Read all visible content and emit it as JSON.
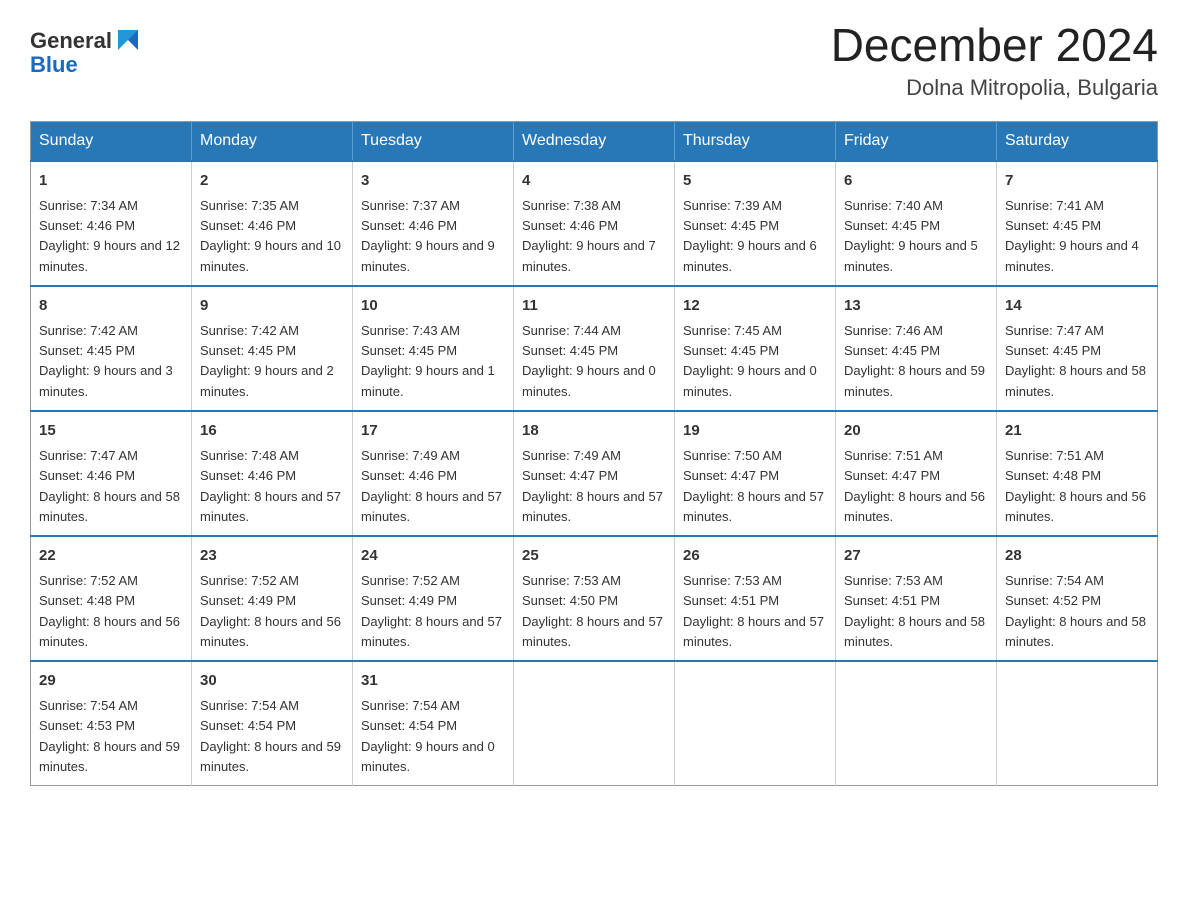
{
  "logo": {
    "text_general": "General",
    "text_blue": "Blue"
  },
  "header": {
    "month_title": "December 2024",
    "location": "Dolna Mitropolia, Bulgaria"
  },
  "weekdays": [
    "Sunday",
    "Monday",
    "Tuesday",
    "Wednesday",
    "Thursday",
    "Friday",
    "Saturday"
  ],
  "weeks": [
    [
      {
        "day": "1",
        "sunrise": "7:34 AM",
        "sunset": "4:46 PM",
        "daylight": "9 hours and 12 minutes."
      },
      {
        "day": "2",
        "sunrise": "7:35 AM",
        "sunset": "4:46 PM",
        "daylight": "9 hours and 10 minutes."
      },
      {
        "day": "3",
        "sunrise": "7:37 AM",
        "sunset": "4:46 PM",
        "daylight": "9 hours and 9 minutes."
      },
      {
        "day": "4",
        "sunrise": "7:38 AM",
        "sunset": "4:46 PM",
        "daylight": "9 hours and 7 minutes."
      },
      {
        "day": "5",
        "sunrise": "7:39 AM",
        "sunset": "4:45 PM",
        "daylight": "9 hours and 6 minutes."
      },
      {
        "day": "6",
        "sunrise": "7:40 AM",
        "sunset": "4:45 PM",
        "daylight": "9 hours and 5 minutes."
      },
      {
        "day": "7",
        "sunrise": "7:41 AM",
        "sunset": "4:45 PM",
        "daylight": "9 hours and 4 minutes."
      }
    ],
    [
      {
        "day": "8",
        "sunrise": "7:42 AM",
        "sunset": "4:45 PM",
        "daylight": "9 hours and 3 minutes."
      },
      {
        "day": "9",
        "sunrise": "7:42 AM",
        "sunset": "4:45 PM",
        "daylight": "9 hours and 2 minutes."
      },
      {
        "day": "10",
        "sunrise": "7:43 AM",
        "sunset": "4:45 PM",
        "daylight": "9 hours and 1 minute."
      },
      {
        "day": "11",
        "sunrise": "7:44 AM",
        "sunset": "4:45 PM",
        "daylight": "9 hours and 0 minutes."
      },
      {
        "day": "12",
        "sunrise": "7:45 AM",
        "sunset": "4:45 PM",
        "daylight": "9 hours and 0 minutes."
      },
      {
        "day": "13",
        "sunrise": "7:46 AM",
        "sunset": "4:45 PM",
        "daylight": "8 hours and 59 minutes."
      },
      {
        "day": "14",
        "sunrise": "7:47 AM",
        "sunset": "4:45 PM",
        "daylight": "8 hours and 58 minutes."
      }
    ],
    [
      {
        "day": "15",
        "sunrise": "7:47 AM",
        "sunset": "4:46 PM",
        "daylight": "8 hours and 58 minutes."
      },
      {
        "day": "16",
        "sunrise": "7:48 AM",
        "sunset": "4:46 PM",
        "daylight": "8 hours and 57 minutes."
      },
      {
        "day": "17",
        "sunrise": "7:49 AM",
        "sunset": "4:46 PM",
        "daylight": "8 hours and 57 minutes."
      },
      {
        "day": "18",
        "sunrise": "7:49 AM",
        "sunset": "4:47 PM",
        "daylight": "8 hours and 57 minutes."
      },
      {
        "day": "19",
        "sunrise": "7:50 AM",
        "sunset": "4:47 PM",
        "daylight": "8 hours and 57 minutes."
      },
      {
        "day": "20",
        "sunrise": "7:51 AM",
        "sunset": "4:47 PM",
        "daylight": "8 hours and 56 minutes."
      },
      {
        "day": "21",
        "sunrise": "7:51 AM",
        "sunset": "4:48 PM",
        "daylight": "8 hours and 56 minutes."
      }
    ],
    [
      {
        "day": "22",
        "sunrise": "7:52 AM",
        "sunset": "4:48 PM",
        "daylight": "8 hours and 56 minutes."
      },
      {
        "day": "23",
        "sunrise": "7:52 AM",
        "sunset": "4:49 PM",
        "daylight": "8 hours and 56 minutes."
      },
      {
        "day": "24",
        "sunrise": "7:52 AM",
        "sunset": "4:49 PM",
        "daylight": "8 hours and 57 minutes."
      },
      {
        "day": "25",
        "sunrise": "7:53 AM",
        "sunset": "4:50 PM",
        "daylight": "8 hours and 57 minutes."
      },
      {
        "day": "26",
        "sunrise": "7:53 AM",
        "sunset": "4:51 PM",
        "daylight": "8 hours and 57 minutes."
      },
      {
        "day": "27",
        "sunrise": "7:53 AM",
        "sunset": "4:51 PM",
        "daylight": "8 hours and 58 minutes."
      },
      {
        "day": "28",
        "sunrise": "7:54 AM",
        "sunset": "4:52 PM",
        "daylight": "8 hours and 58 minutes."
      }
    ],
    [
      {
        "day": "29",
        "sunrise": "7:54 AM",
        "sunset": "4:53 PM",
        "daylight": "8 hours and 59 minutes."
      },
      {
        "day": "30",
        "sunrise": "7:54 AM",
        "sunset": "4:54 PM",
        "daylight": "8 hours and 59 minutes."
      },
      {
        "day": "31",
        "sunrise": "7:54 AM",
        "sunset": "4:54 PM",
        "daylight": "9 hours and 0 minutes."
      },
      null,
      null,
      null,
      null
    ]
  ]
}
